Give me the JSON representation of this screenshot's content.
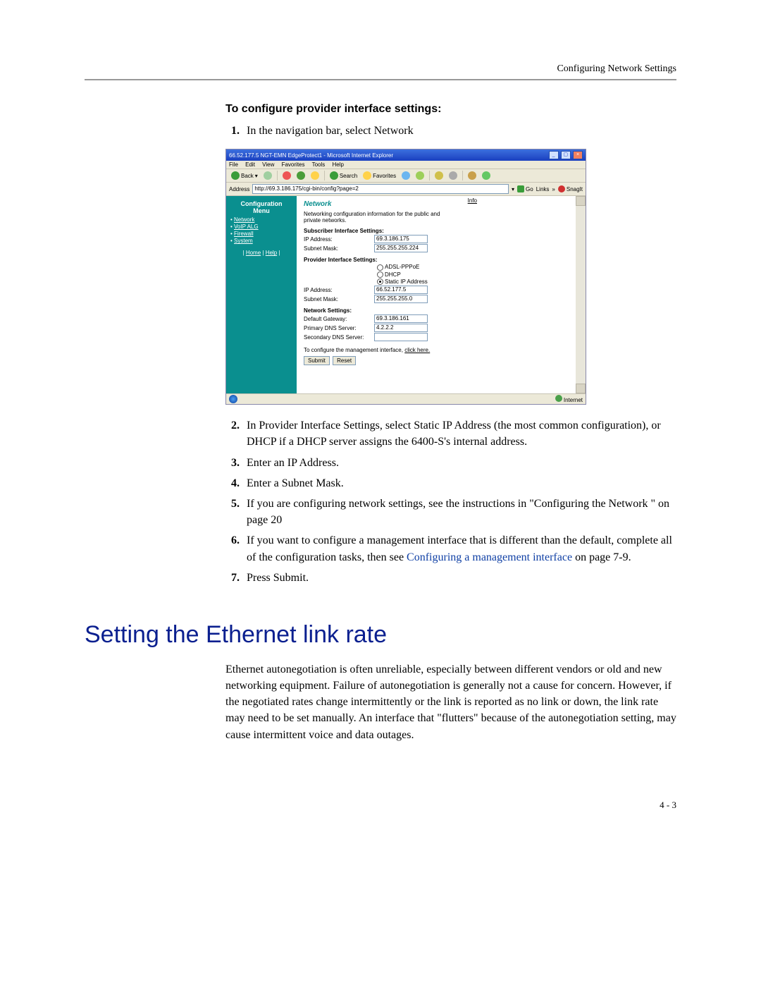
{
  "header": {
    "right": "Configuring Network Settings"
  },
  "subhead": "To configure provider interface settings:",
  "steps": {
    "s1": "In the navigation bar, select Network",
    "s2": "In Provider Interface Settings, select Static IP Address (the most common configuration), or DHCP if a DHCP server assigns the 6400-S's internal address.",
    "s3": "Enter an IP Address.",
    "s4": "Enter a Subnet Mask.",
    "s5": "If you are configuring network settings, see the instructions in \"Configuring the Network \" on page 20",
    "s6_a": "If you want to configure a management interface that is different than the default, complete all of the configuration tasks, then see ",
    "s6_link": "Configuring a management interface",
    "s6_b": " on page 7-9.",
    "s7": "Press Submit."
  },
  "section_title": "Setting the Ethernet link rate",
  "body_para": "Ethernet autonegotiation is often unreliable, especially between different vendors or old and new networking equipment. Failure of autonegotiation is generally not a cause for concern. However, if the negotiated rates change intermittently or the link is reported as no link or down, the link rate may need to be set manually. An interface that \"flutters\" because of the autonegotiation setting, may cause intermittent voice and data outages.",
  "page_num": "4 - 3",
  "ie": {
    "title": "66.52.177.5 NGT-EMN EdgeProtect1 - Microsoft Internet Explorer",
    "menu": {
      "file": "File",
      "edit": "Edit",
      "view": "View",
      "fav": "Favorites",
      "tools": "Tools",
      "help": "Help"
    },
    "tb": {
      "back": "Back",
      "search": "Search",
      "favorites": "Favorites"
    },
    "addr_label": "Address",
    "addr": "http://69.3.186.175/cgi-bin/config?page=2",
    "go": "Go",
    "links": "Links",
    "snagit": "SnagIt",
    "sidebar": {
      "heading_l1": "Configuration",
      "heading_l2": "Menu",
      "items": [
        "Network",
        "VoIP ALG",
        "Firewall",
        "System"
      ],
      "home": "Home",
      "help": "Help"
    },
    "content": {
      "heading": "Network",
      "info": "Info",
      "desc": "Networking configuration information for the public and private networks.",
      "sub_iface_h": "Subscriber Interface Settings:",
      "ip_label": "IP Address:",
      "mask_label": "Subnet Mask:",
      "sub_ip": "69.3.186.175",
      "sub_mask": "255.255.255.224",
      "prov_iface_h": "Provider Interface Settings:",
      "radio_adsl": "ADSL-PPPoE",
      "radio_dhcp": "DHCP",
      "radio_static": "Static IP Address",
      "prov_ip": "66.52.177.5",
      "prov_mask": "255.255.255.0",
      "net_h": "Network Settings:",
      "gw_label": "Default Gateway:",
      "gw": "69.3.186.161",
      "dns1_label": "Primary DNS Server:",
      "dns1": "4.2.2.2",
      "dns2_label": "Secondary DNS Server:",
      "mgmt_a": "To configure the management interface, ",
      "mgmt_link": "click here.",
      "submit": "Submit",
      "reset": "Reset"
    },
    "status": {
      "internet": "Internet"
    }
  }
}
